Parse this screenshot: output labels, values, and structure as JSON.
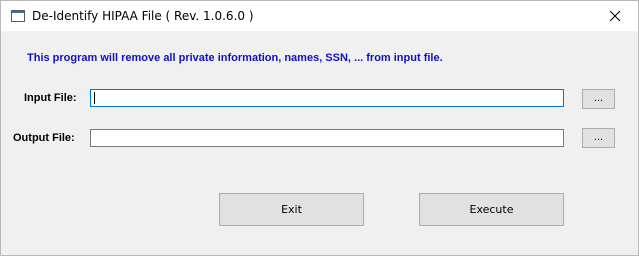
{
  "window": {
    "title": "De-Identify HIPAA File   ( Rev. 1.0.6.0 )"
  },
  "form": {
    "info_text": "This program will remove all private information, names, SSN, ... from input file.",
    "input_label": "Input File:",
    "input_value": "",
    "output_label": "Output File:",
    "output_value": "",
    "browse_label": "..."
  },
  "buttons": {
    "exit": "Exit",
    "execute": "Execute"
  },
  "colors": {
    "info_text": "#1010c8",
    "focus_border": "#0078d7"
  },
  "icons": {
    "app": "app-window-icon",
    "close": "close-icon"
  }
}
